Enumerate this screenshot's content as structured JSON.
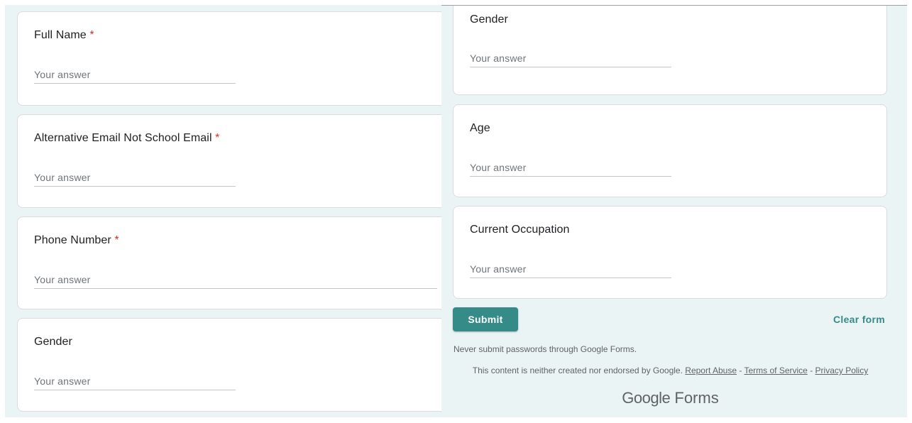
{
  "left_panel": {
    "questions": [
      {
        "title": "Full Name",
        "required_mark": "*",
        "placeholder": "Your answer"
      },
      {
        "title": "Alternative Email Not School Email",
        "required_mark": "*",
        "placeholder": "Your answer"
      },
      {
        "title": "Phone Number",
        "required_mark": "*",
        "placeholder": "Your answer"
      },
      {
        "title": "Gender",
        "required_mark": "",
        "placeholder": "Your answer"
      }
    ]
  },
  "right_panel": {
    "questions": [
      {
        "title": "Gender",
        "placeholder": "Your answer"
      },
      {
        "title": "Age",
        "placeholder": "Your answer"
      },
      {
        "title": "Current Occupation",
        "placeholder": "Your answer"
      }
    ],
    "submit_label": "Submit",
    "clear_label": "Clear form",
    "password_warning": "Never submit passwords through Google Forms.",
    "disclaimer_text": "This content is neither created nor endorsed by Google.",
    "report_abuse": "Report Abuse",
    "terms": "Terms of Service",
    "privacy": "Privacy Policy",
    "separator": "-",
    "logo_google": "Google",
    "logo_forms": "Forms"
  },
  "colors": {
    "accent": "#358b87",
    "background": "#ebf4f5",
    "required": "#d93025"
  }
}
